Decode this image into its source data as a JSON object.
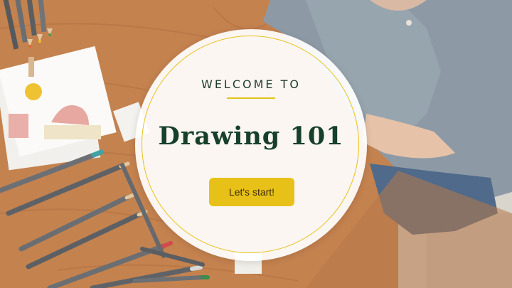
{
  "slide": {
    "kicker": "WELCOME TO",
    "title": "Drawing 101",
    "start_label": "Let's start!"
  },
  "colors": {
    "accent": "#e6c21a",
    "title": "#17402a",
    "button": "#e8c118"
  },
  "photo": {
    "subject": "desk-with-colored-pencils-and-person-in-sweater"
  }
}
